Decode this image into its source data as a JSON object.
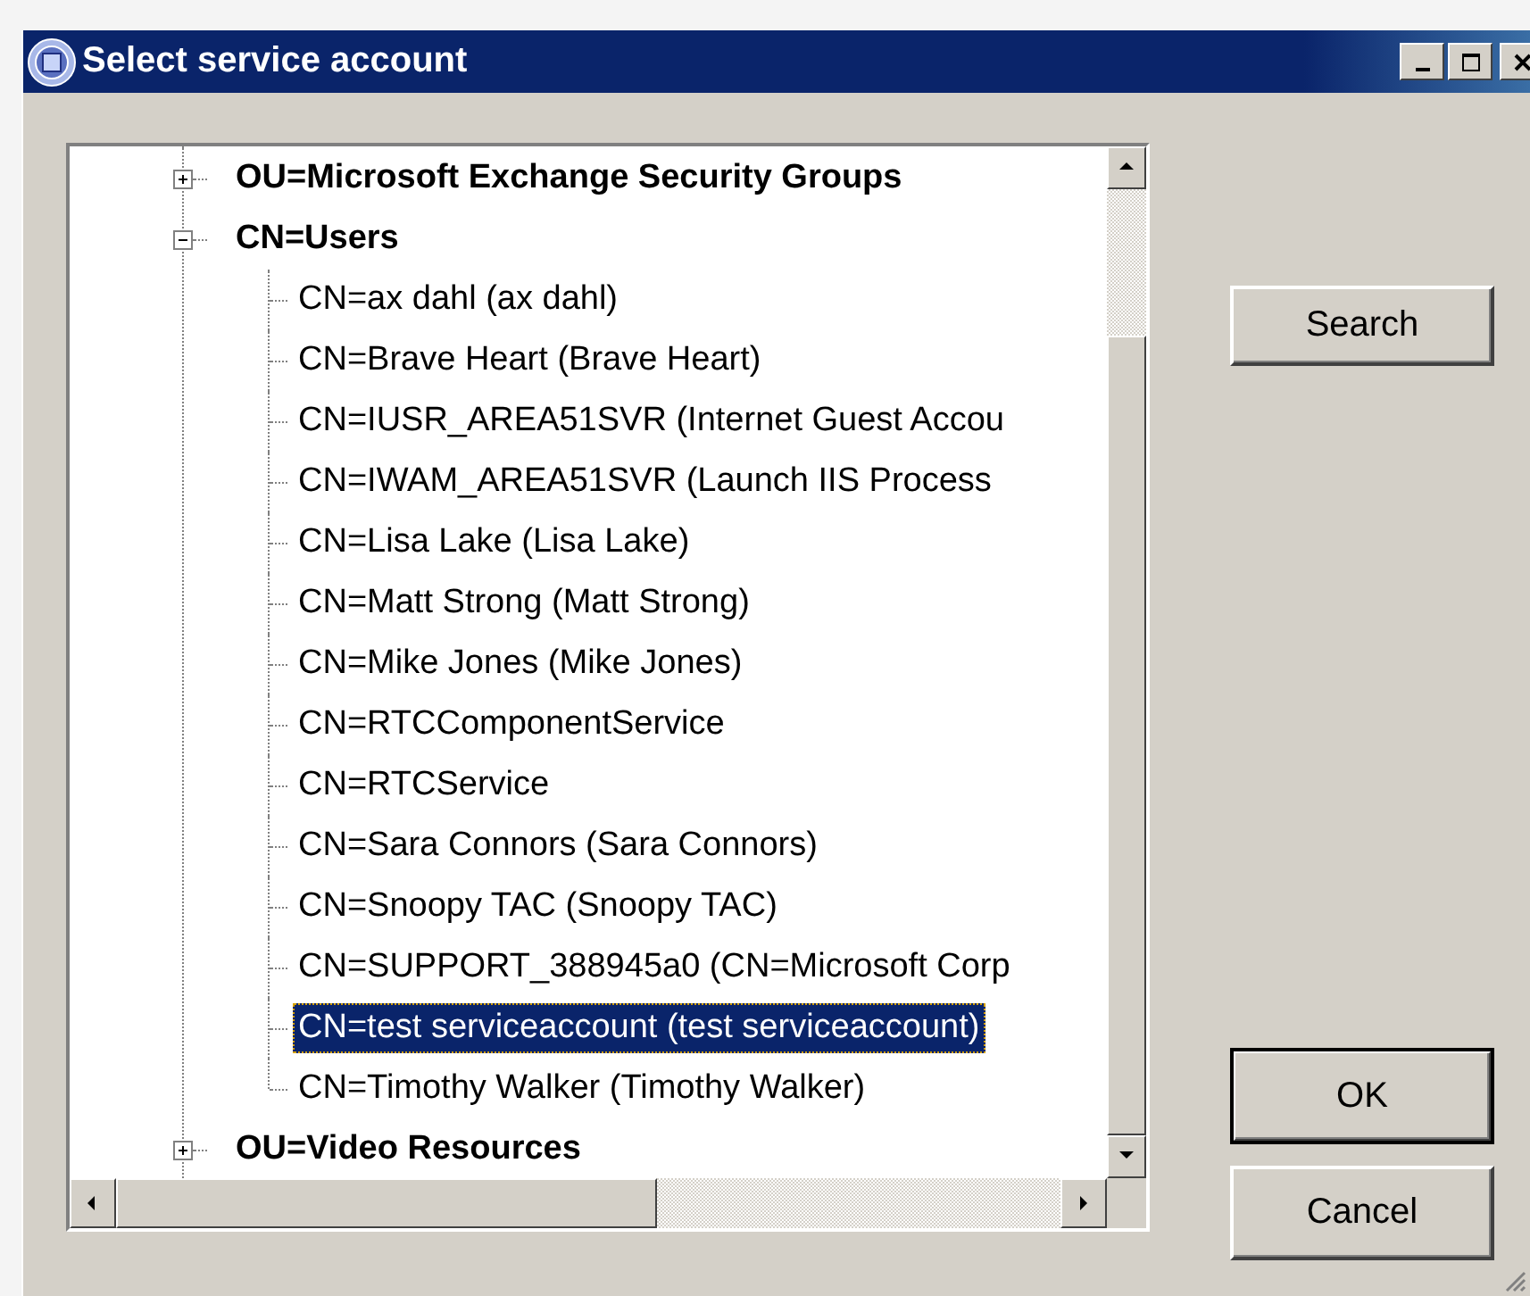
{
  "window": {
    "title": "Select service account"
  },
  "tree": {
    "items": [
      {
        "label": "OU=Microsoft Exchange Security Groups",
        "expanded": false,
        "selected": false
      },
      {
        "label": "CN=Users",
        "expanded": true,
        "selected": false,
        "children": [
          {
            "label": "CN=ax dahl (ax dahl)",
            "selected": false
          },
          {
            "label": "CN=Brave Heart (Brave Heart)",
            "selected": false
          },
          {
            "label": "CN=IUSR_AREA51SVR (Internet Guest Accou",
            "selected": false
          },
          {
            "label": "CN=IWAM_AREA51SVR (Launch IIS Process",
            "selected": false
          },
          {
            "label": "CN=Lisa Lake (Lisa Lake)",
            "selected": false
          },
          {
            "label": "CN=Matt Strong (Matt Strong)",
            "selected": false
          },
          {
            "label": "CN=Mike Jones (Mike Jones)",
            "selected": false
          },
          {
            "label": "CN=RTCComponentService",
            "selected": false
          },
          {
            "label": "CN=RTCService",
            "selected": false
          },
          {
            "label": "CN=Sara Connors (Sara Connors)",
            "selected": false
          },
          {
            "label": "CN=Snoopy TAC (Snoopy TAC)",
            "selected": false
          },
          {
            "label": "CN=SUPPORT_388945a0 (CN=Microsoft Corp",
            "selected": false
          },
          {
            "label": "CN=test serviceaccount (test serviceaccount)",
            "selected": true
          },
          {
            "label": "CN=Timothy Walker (Timothy Walker)",
            "selected": false
          }
        ]
      },
      {
        "label": "OU=Video Resources",
        "expanded": false,
        "selected": false
      }
    ]
  },
  "buttons": [
    {
      "label": "Search",
      "default": false
    },
    {
      "label": "OK",
      "default": true
    },
    {
      "label": "Cancel",
      "default": false
    }
  ]
}
